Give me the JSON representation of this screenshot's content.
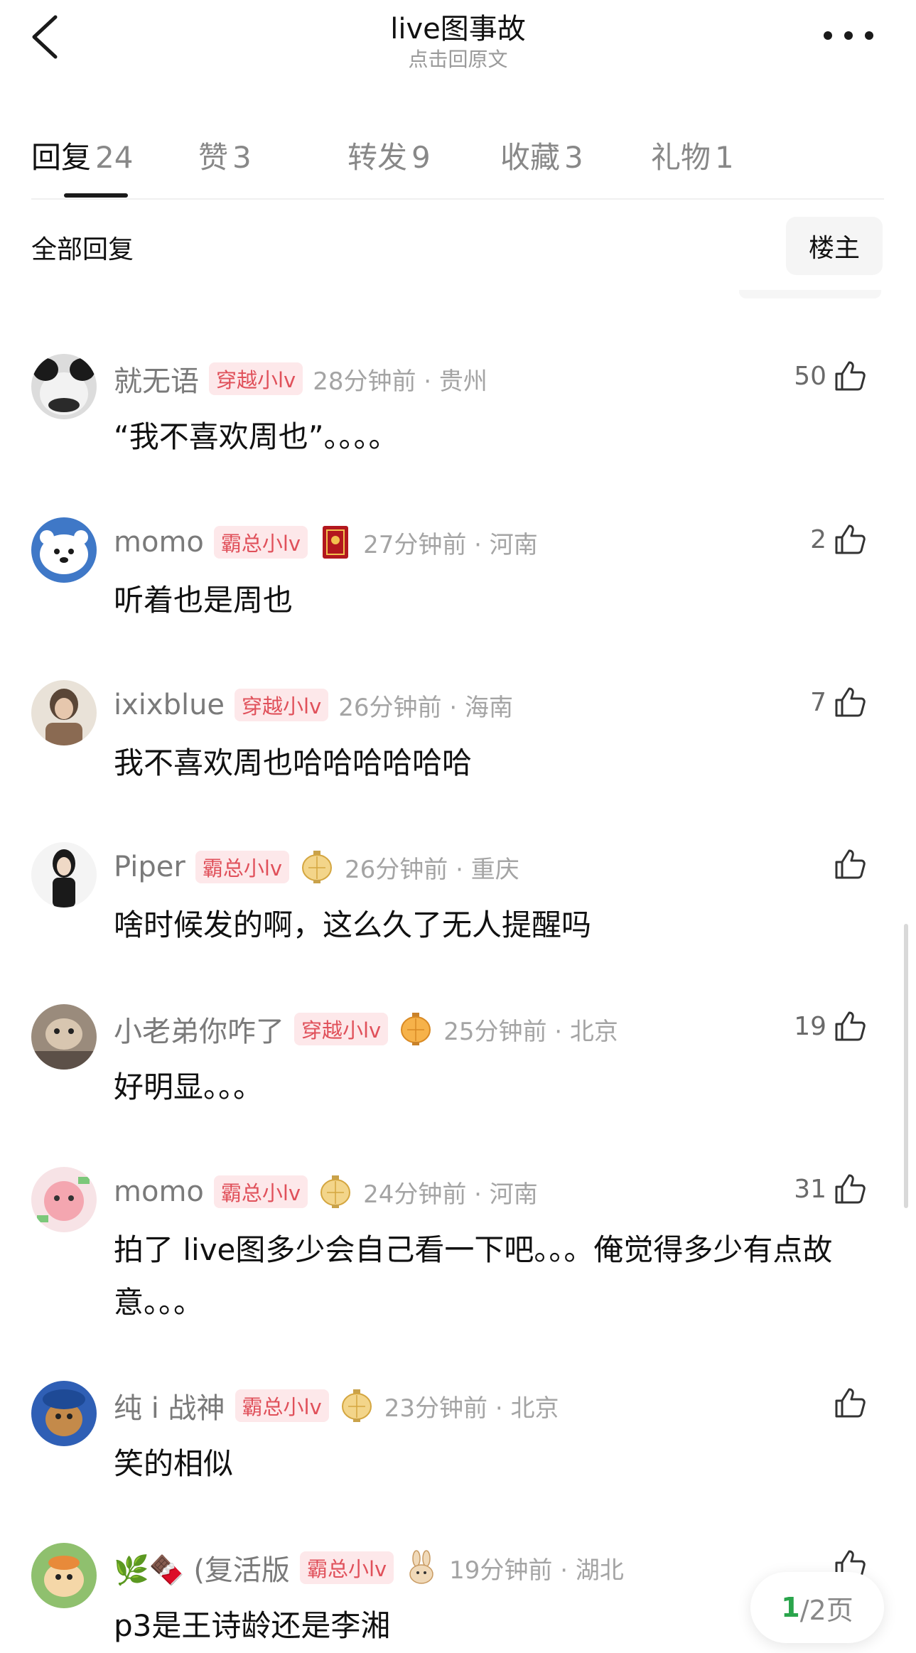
{
  "header": {
    "title": "live图事故",
    "subtitle": "点击回原文"
  },
  "tabs": [
    {
      "label": "回复",
      "count": "24",
      "active": true
    },
    {
      "label": "赞",
      "count": "3",
      "active": false
    },
    {
      "label": "转发",
      "count": "9",
      "active": false
    },
    {
      "label": "收藏",
      "count": "3",
      "active": false
    },
    {
      "label": "礼物",
      "count": "1",
      "active": false
    }
  ],
  "filter": {
    "all_label": "全部回复",
    "op_label": "楼主"
  },
  "comments": [
    {
      "username": "就无语",
      "badge": "穿越小lv",
      "medal": "",
      "time": "28分钟前 · 贵州",
      "likes": "50",
      "text": "“我不喜欢周也”。。。。"
    },
    {
      "username": "momo",
      "badge": "霸总小lv",
      "medal": "red-book-icon",
      "time": "27分钟前 · 河南",
      "likes": "2",
      "text": "听着也是周也"
    },
    {
      "username": "ixixblue",
      "badge": "穿越小lv",
      "medal": "",
      "time": "26分钟前 · 海南",
      "likes": "7",
      "text": "我不喜欢周也哈哈哈哈哈哈"
    },
    {
      "username": "Piper",
      "badge": "霸总小lv",
      "medal": "lantern-icon",
      "time": "26分钟前 · 重庆",
      "likes": "",
      "text": "啥时候发的啊，这么久了无人提醒吗"
    },
    {
      "username": "小老弟你咋了",
      "badge": "穿越小lv",
      "medal": "lantern-orange-icon",
      "time": "25分钟前 · 北京",
      "likes": "19",
      "text": "好明显。。。"
    },
    {
      "username": "momo",
      "badge": "霸总小lv",
      "medal": "lantern-icon",
      "time": "24分钟前 · 河南",
      "likes": "31",
      "text": "拍了 live图多少会自己看一下吧。。。俺觉得多少有点故意。。。"
    },
    {
      "username": "纯 i 战神",
      "badge": "霸总小lv",
      "medal": "lantern-icon",
      "time": "23分钟前 · 北京",
      "likes": "",
      "text": "笑的相似"
    },
    {
      "username": "🌿🍫 (复活版",
      "badge": "霸总小lv",
      "medal": "rabbit-icon",
      "time": "19分钟前 · 湖北",
      "likes": "",
      "text": "p3是王诗龄还是李湘"
    }
  ],
  "pager": {
    "current": "1",
    "total": "/2页"
  },
  "colors": {
    "badge_text": "#e0505a",
    "badge_bg": "#fde8ea",
    "pager_current": "#2aa54c"
  }
}
